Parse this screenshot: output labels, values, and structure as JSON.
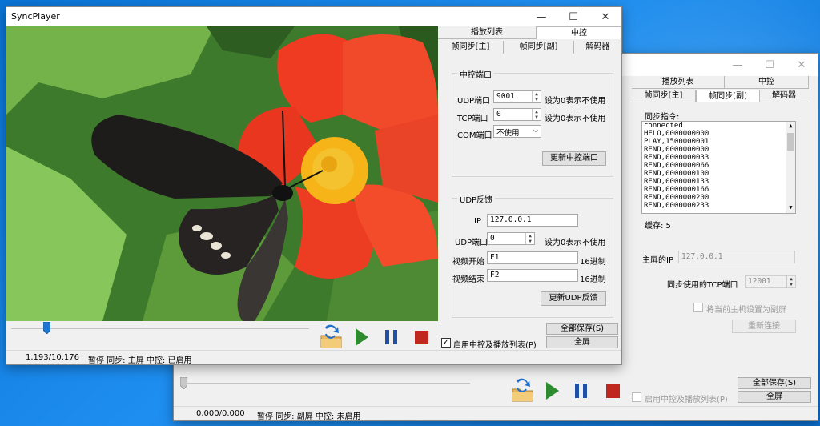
{
  "app_title": "SyncPlayer",
  "window_controls": {
    "minimize": "—",
    "maximize": "☐",
    "close": "✕"
  },
  "colors": {
    "play": "#2e8b2e",
    "pause": "#1f4fa6",
    "stop": "#c0281f",
    "seek_thumb": "#1e78d2"
  },
  "secondary": {
    "tabs_row1": [
      "播放列表",
      "中控"
    ],
    "tabs_row2": [
      "帧同步[主]",
      "帧同步[副]",
      "解码器"
    ],
    "active_tab": "帧同步[副]",
    "sync_cmd_label": "同步指令:",
    "sync_lines": [
      "connected",
      "HELO,0000000000",
      "PLAY,1500000001",
      "REND,0000000000",
      "REND,0000000033",
      "REND,0000000066",
      "REND,0000000100",
      "REND,0000000133",
      "REND,0000000166",
      "REND,0000000200",
      "REND,0000000233"
    ],
    "cache_label": "缓存: 5",
    "master_ip_label": "主屏的IP",
    "master_ip_value": "127.0.0.1",
    "sync_port_label": "同步使用的TCP端口",
    "sync_port_value": "12001",
    "set_secondary_label": "将当前主机设置为副屏",
    "reconnect_label": "重新连接",
    "save_all_label": "全部保存(S)",
    "fullscreen_label": "全屏",
    "enable_label": "启用中控及播放列表(P)",
    "time": "0.000/0.000",
    "status": "暂停  同步: 副屏  中控: 未启用",
    "progress": 0.0
  },
  "main": {
    "tabs_row1": [
      "播放列表",
      "中控"
    ],
    "tabs_row2": [
      "帧同步[主]",
      "帧同步[副]",
      "解码器"
    ],
    "active_tab": "中控",
    "group_control_port": "中控端口",
    "udp_port_label": "UDP端口",
    "udp_port_value": "9001",
    "tcp_port_label": "TCP端口",
    "tcp_port_value": "0",
    "com_port_label": "COM端口",
    "com_port_value": "不使用",
    "zero_hint": "设为0表示不使用",
    "update_control_port": "更新中控端口",
    "group_udp_feedback": "UDP反馈",
    "ip_label": "IP",
    "ip_value": "127.0.0.1",
    "fb_udp_port_label": "UDP端口",
    "fb_udp_port_value": "0",
    "video_start_label": "视频开始",
    "video_start_value": "F1",
    "video_end_label": "视频结束",
    "video_end_value": "F2",
    "hex_hint": "16进制",
    "update_udp_feedback": "更新UDP反馈",
    "save_all_label": "全部保存(S)",
    "fullscreen_label": "全屏",
    "enable_label": "启用中控及播放列表(P)",
    "enable_checked": true,
    "time": "1.193/10.176",
    "status": "暂停  同步: 主屏  中控: 已启用",
    "progress": 0.117
  }
}
